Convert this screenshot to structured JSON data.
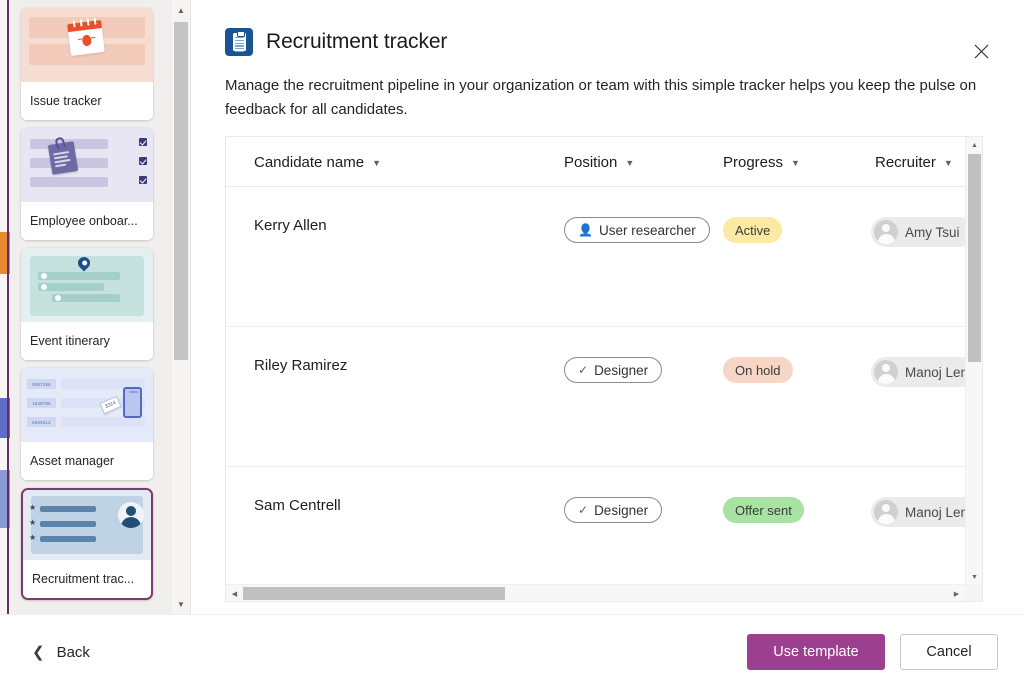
{
  "sidebar": {
    "scroll_up_icon": "triangle-up-icon",
    "scroll_down_icon": "triangle-down-icon",
    "items": [
      {
        "label": "Issue tracker",
        "art": "issue",
        "selected": false
      },
      {
        "label": "Employee onboar...",
        "art": "emp",
        "selected": false
      },
      {
        "label": "Event itinerary",
        "art": "event",
        "selected": false
      },
      {
        "label": "Asset manager",
        "art": "asset",
        "selected": false
      },
      {
        "label": "Recruitment trac...",
        "art": "recr",
        "selected": true
      }
    ],
    "asset_numbers": [
      "5687156",
      "1649786",
      "5566512"
    ],
    "asset_tag_text": "3314"
  },
  "dialog": {
    "icon": "clipboard-icon",
    "title": "Recruitment tracker",
    "close_icon": "close-icon",
    "description": "Manage the recruitment pipeline in your organization or team with this simple tracker helps you keep the pulse on feedback for all candidates.",
    "accent_color": "#9c3f8e"
  },
  "table": {
    "sort_icon": "chevron-down-icon",
    "columns": [
      {
        "key": "candidate_name",
        "label": "Candidate name"
      },
      {
        "key": "position",
        "label": "Position"
      },
      {
        "key": "progress",
        "label": "Progress"
      },
      {
        "key": "recruiter",
        "label": "Recruiter"
      }
    ],
    "rows": [
      {
        "candidate_name": "Kerry Allen",
        "position": "User researcher",
        "position_icon": "person-icon",
        "progress": "Active",
        "progress_color": "#fce9a4",
        "recruiter": "Amy Tsui",
        "avatar_icon": "avatar-icon"
      },
      {
        "candidate_name": "Riley Ramirez",
        "position": "Designer",
        "position_icon": "check-icon",
        "progress": "On hold",
        "progress_color": "#f7d6c5",
        "recruiter": "Manoj Lenl",
        "avatar_icon": "avatar-icon"
      },
      {
        "candidate_name": "Sam Centrell",
        "position": "Designer",
        "position_icon": "check-icon",
        "progress": "Offer sent",
        "progress_color": "#a8e3a2",
        "recruiter": "Manoj Lenl",
        "avatar_icon": "avatar-icon"
      }
    ]
  },
  "footer": {
    "back_label": "Back",
    "back_icon": "chevron-left-icon",
    "use_template_label": "Use template",
    "cancel_label": "Cancel"
  }
}
